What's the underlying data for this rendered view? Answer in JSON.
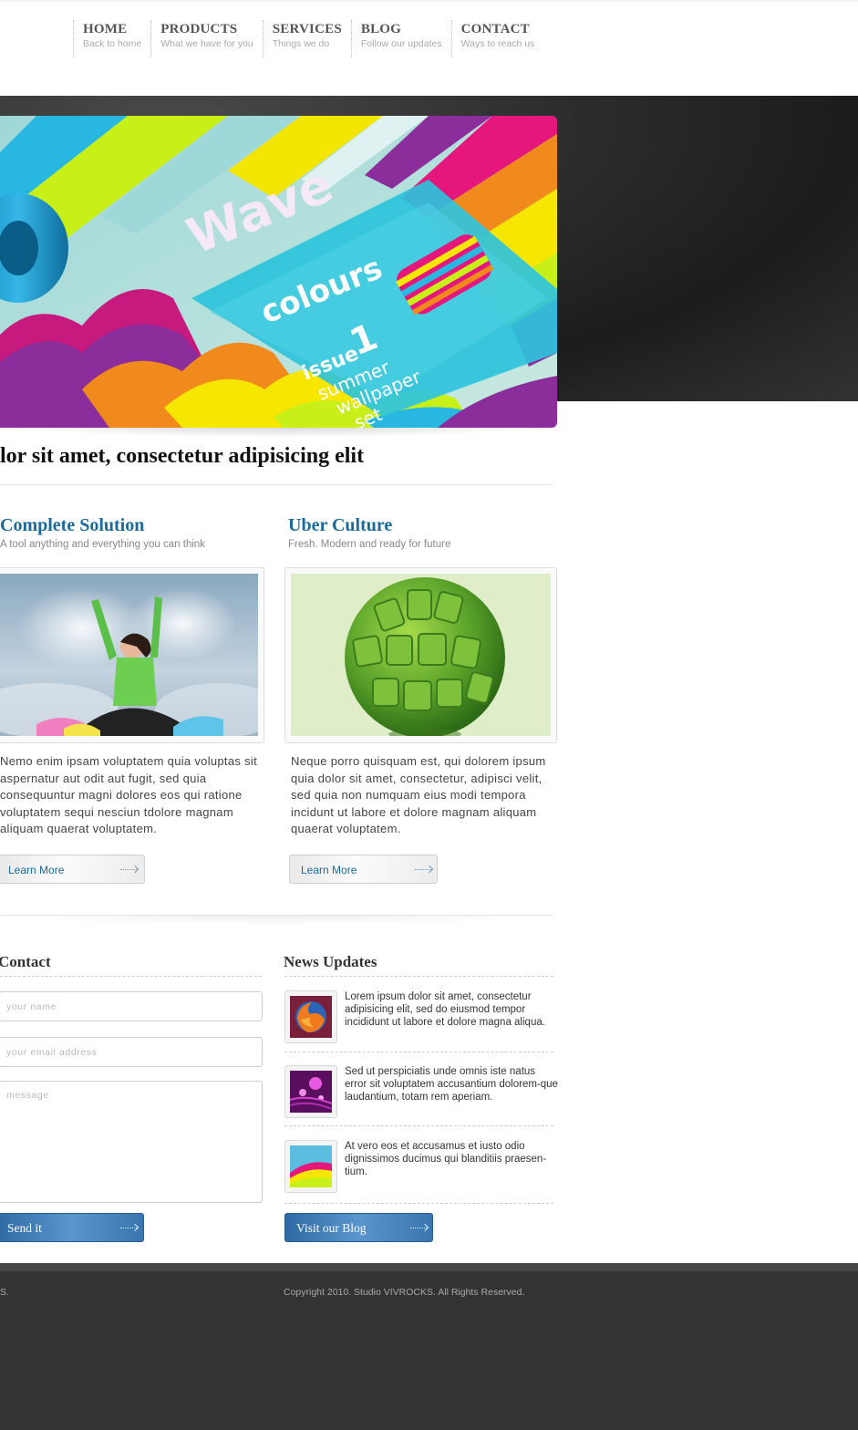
{
  "nav": {
    "items": [
      {
        "title": "HOME",
        "sub": "Back to home"
      },
      {
        "title": "PRODUCTS",
        "sub": "What we have for you"
      },
      {
        "title": "SERVICES",
        "sub": "Things we do"
      },
      {
        "title": "BLOG",
        "sub": "Follow our updates"
      },
      {
        "title": "CONTACT",
        "sub": "Ways to reach us"
      }
    ]
  },
  "hero": {
    "word1": "Wave",
    "word2": "colours",
    "word3": "issue",
    "number": "1",
    "line1": "summer",
    "line2": "wallpaper",
    "line3": "set"
  },
  "headline": "lor sit amet, consectetur adipisicing elit",
  "features": [
    {
      "title": "Complete Solution",
      "subtitle": "A tool anything and everything you can think",
      "text": "Nemo enim ipsam voluptatem quia voluptas sit aspernatur aut odit aut fugit, sed quia consequuntur magni dolores eos qui ratione voluptatem sequi nesciun tdolore magnam aliquam quaerat voluptatem.",
      "button": "Learn More"
    },
    {
      "title": "Uber Culture",
      "subtitle": "Fresh. Modern and ready for future",
      "text": "Neque porro quisquam est, qui dolorem ipsum quia dolor sit amet, consectetur, adipisci velit, sed quia non numquam eius modi tempora incidunt ut labore et dolore magnam aliquam quaerat voluptatem.",
      "button": "Learn More"
    }
  ],
  "contact": {
    "title": "Contact",
    "name_placeholder": "your name",
    "email_placeholder": "your email address",
    "message_placeholder": "message",
    "send_label": "Send it"
  },
  "news": {
    "title": "News Updates",
    "items": [
      {
        "text": "Lorem ipsum dolor sit amet, consectetur adipisicing elit, sed do eiusmod tempor incididunt ut labore et dolore magna aliqua."
      },
      {
        "text": "Sed ut perspiciatis unde omnis iste natus error sit voluptatem accusantium dolorem-que laudantium, totam rem aperiam."
      },
      {
        "text": "At vero eos et accusamus et iusto odio dignissimos ducimus qui blanditiis praesen-tium."
      }
    ],
    "blog_label": "Visit our Blog"
  },
  "footer": {
    "left": "S.",
    "copyright": "Copyright 2010. Studio VIVROCKS. All Rights Reserved."
  },
  "colors": {
    "accent_blue": "#1a6a9c",
    "button_blue": "#3a75b0",
    "footer_bg": "#333333"
  }
}
